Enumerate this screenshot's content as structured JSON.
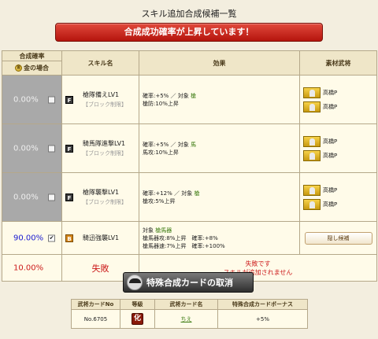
{
  "page_title": "スキル追加合成候補一覧",
  "banner_text": "合成成功確率が上昇しています！",
  "headers": {
    "rate": "合成確率",
    "gold_case": "金の場合",
    "gold_coin_glyph": "金",
    "skill": "スキル名",
    "effect": "効果",
    "material": "素材武将"
  },
  "rows": [
    {
      "rate": "0.00%",
      "checked": false,
      "rank": "F",
      "skill_name": "槍隊備えLV1",
      "skill_sub": "【ブロック制限】",
      "effect_line1_pre": "確率:+5% ／ 対象 ",
      "effect_line1_target": "槍",
      "effect_line2": "槍防:10%上昇",
      "materials": [
        "高橋P",
        "高橋P"
      ]
    },
    {
      "rate": "0.00%",
      "checked": false,
      "rank": "F",
      "skill_name": "騎馬隊進撃LV1",
      "skill_sub": "【ブロック制限】",
      "effect_line1_pre": "確率:+5% ／ 対象 ",
      "effect_line1_target": "馬",
      "effect_line2": "馬攻:10%上昇",
      "materials": [
        "高橋P",
        "高橋P"
      ]
    },
    {
      "rate": "0.00%",
      "checked": false,
      "rank": "F",
      "skill_name": "槍隊襲撃LV1",
      "skill_sub": "【ブロック制限】",
      "effect_line1_pre": "確率:+12% ／ 対象 ",
      "effect_line1_target": "槍",
      "effect_line2": "槍攻:5%上昇",
      "materials": [
        "高橋P",
        "高橋P"
      ]
    }
  ],
  "row_selected": {
    "rate": "90.00%",
    "checked": true,
    "check_glyph": "✔",
    "rank": "B",
    "skill_name": "騎迅強襲LV1",
    "effect_line1_pre": "対象 ",
    "effect_line1_target": "槍馬器",
    "effect_line2": "槍馬器攻:8%上昇　確率:+8%",
    "effect_line3": "槍馬器速:7%上昇　確率:+100%",
    "hide_button": "隠し候補"
  },
  "row_fail": {
    "rate": "10.00%",
    "label": "失敗",
    "msg1": "失敗です",
    "msg2": "スキルが追加されません"
  },
  "cancel_button": "特殊合成カードの取消",
  "card_table": {
    "headers": [
      "武将カードNo",
      "等級",
      "武将カード名",
      "特殊合成カードボーナス"
    ],
    "no": "No.6705",
    "grade": "化",
    "name": "ちえ",
    "bonus": "+5%"
  },
  "colors": {
    "banner": "#c8201a",
    "rate_blue": "#1a1ad0",
    "rate_red": "#cc1a1a",
    "effect_green": "#3a7a10",
    "row_disabled": "#a9a9a9"
  }
}
